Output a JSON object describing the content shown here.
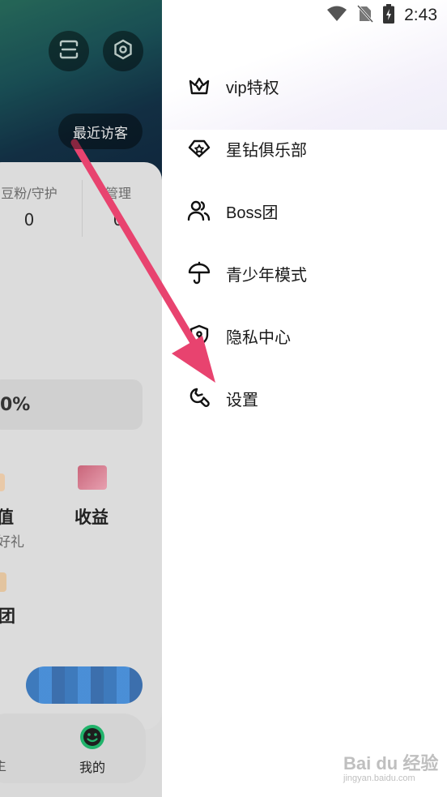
{
  "status_bar": {
    "time": "2:43"
  },
  "profile": {
    "recent_visitors": "最近访客",
    "stats": [
      {
        "label": "豆粉/守护",
        "value": "0"
      },
      {
        "label": "管理",
        "value": "0"
      }
    ],
    "progress_text": "0%",
    "grid": [
      {
        "label": "值",
        "sub": "好礼"
      },
      {
        "label": "收益",
        "sub": ""
      },
      {
        "label": "团",
        "sub": ""
      }
    ],
    "tabs": [
      {
        "label": "主"
      },
      {
        "label": "我的"
      }
    ]
  },
  "drawer": {
    "items": [
      {
        "label": "vip特权",
        "icon": "crown-icon"
      },
      {
        "label": "星钻俱乐部",
        "icon": "diamond-icon"
      },
      {
        "label": "Boss团",
        "icon": "users-icon"
      },
      {
        "label": "青少年模式",
        "icon": "umbrella-icon"
      },
      {
        "label": "隐私中心",
        "icon": "shield-icon"
      },
      {
        "label": "设置",
        "icon": "wrench-icon"
      }
    ]
  },
  "colors": {
    "arrow": "#e8436f",
    "accent_green": "#21b36b"
  },
  "watermark": {
    "main": "Bai du 经验",
    "sub": "jingyan.baidu.com"
  }
}
